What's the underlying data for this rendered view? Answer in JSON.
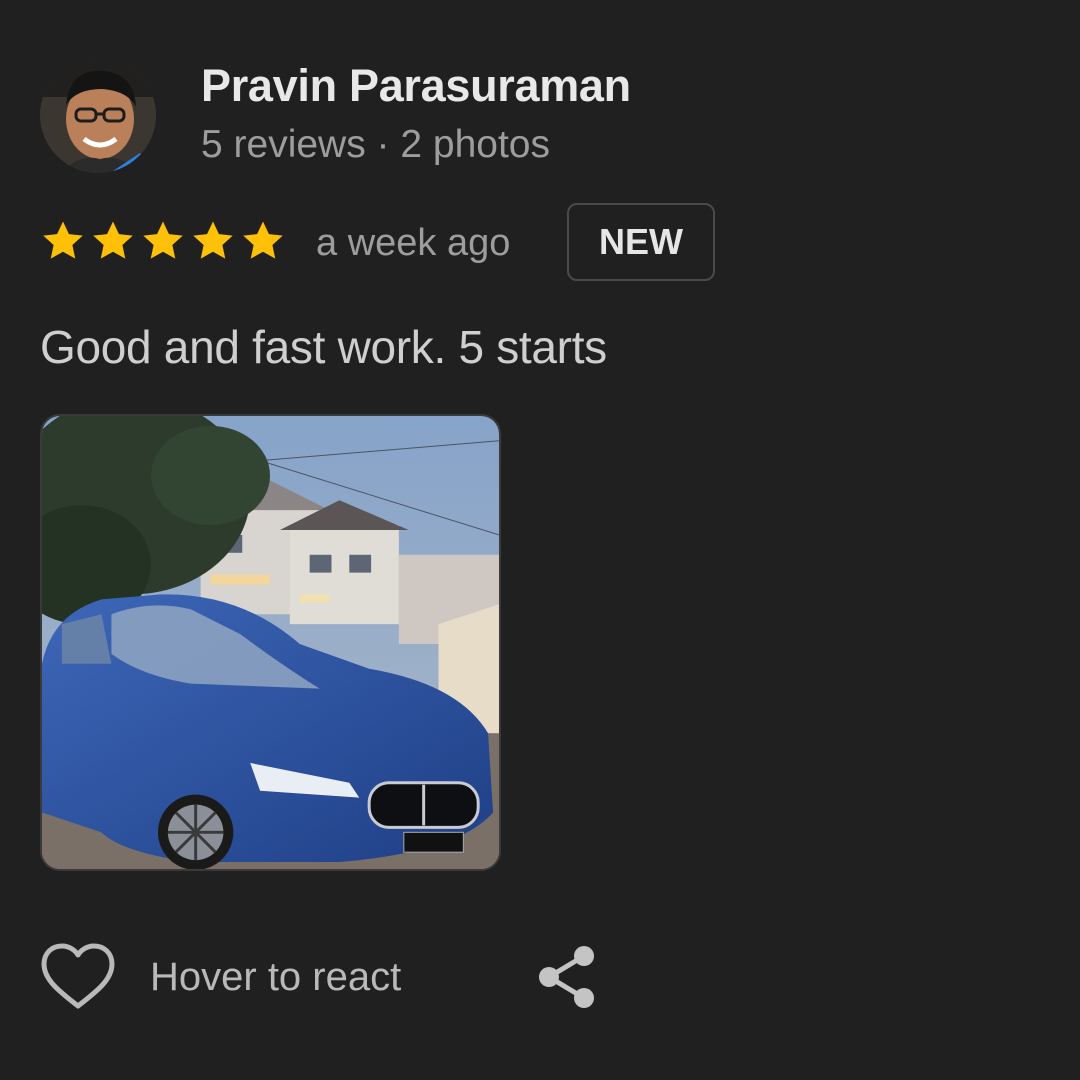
{
  "review": {
    "author": {
      "name": "Pravin Parasuraman",
      "meta": "5 reviews · 2 photos"
    },
    "rating": 5,
    "rating_max": 5,
    "time": "a week ago",
    "badge": "NEW",
    "text": "Good and fast work. 5 starts",
    "photo_icon": "car-photo"
  },
  "actions": {
    "like_icon": "heart-outline-icon",
    "react_label": "Hover to react",
    "share_icon": "share-icon"
  },
  "colors": {
    "background": "#202020",
    "star": "#FFC107",
    "text_primary": "#e8e8e8",
    "text_secondary": "#9d9d9d"
  }
}
